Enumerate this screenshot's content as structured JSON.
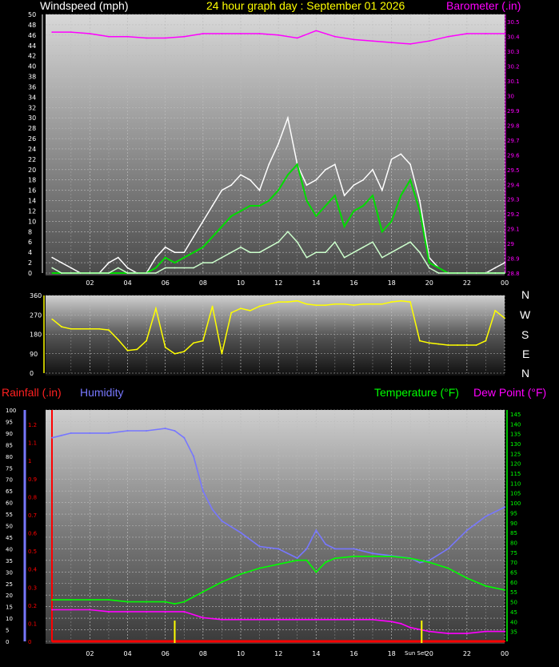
{
  "colors": {
    "wind": "#ffffff",
    "wind_avg": "#00dd00",
    "wind_min": "#ccffcc",
    "barometer": "#ff00ff",
    "direction": "#ffff00",
    "humidity": "#7777ff",
    "temperature": "#00ff00",
    "dewpoint": "#ff00ff",
    "rainfall": "#ff0000",
    "grid": "#bbbbbb"
  },
  "header": {
    "left_label": "Windspeed (mph)",
    "title": "24 hour graph day : September 01 2026",
    "right_label": "Barometer (.in)"
  },
  "lower_header": {
    "rainfall": "Rainfall (.in)",
    "humidity": "Humidity",
    "temperature": "Temperature (°F)",
    "dewpoint": "Dew Point (°F)"
  },
  "compass": [
    "N",
    "W",
    "S",
    "E",
    "N"
  ],
  "x_labels": [
    "02",
    "04",
    "06",
    "08",
    "10",
    "12",
    "14",
    "16",
    "18",
    "20",
    "22",
    "00"
  ],
  "sunset_label": "Sun Set",
  "chart_data": [
    {
      "type": "line",
      "title": "24 hour graph day : September 01 2026",
      "x_hours_ticks": [
        "02",
        "04",
        "06",
        "08",
        "10",
        "12",
        "14",
        "16",
        "18",
        "20",
        "22",
        "00"
      ],
      "y_left_label": "Windspeed (mph)",
      "y_left_ticks": [
        "0",
        "2",
        "4",
        "6",
        "8",
        "10",
        "12",
        "14",
        "16",
        "18",
        "20",
        "22",
        "24",
        "26",
        "28",
        "30",
        "32",
        "34",
        "36",
        "38",
        "40",
        "42",
        "44",
        "46",
        "48",
        "50"
      ],
      "y_right_label": "Barometer (.in)",
      "y_right_ticks": [
        "28.8",
        "28.9",
        "29",
        "29.1",
        "29.2",
        "29.3",
        "29.4",
        "29.5",
        "29.6",
        "29.7",
        "29.8",
        "29.9",
        "30",
        "30.1",
        "30.2",
        "30.3",
        "30.4",
        "30.5"
      ],
      "ylim_left": [
        0,
        50
      ],
      "ylim_right": [
        28.8,
        30.55
      ],
      "series": [
        {
          "color_key": "wind",
          "axis": "left",
          "x": [
            0,
            0.5,
            1,
            1.5,
            2,
            2.5,
            3,
            3.5,
            4,
            4.5,
            5,
            5.5,
            6,
            6.5,
            7,
            7.5,
            8,
            8.5,
            9,
            9.5,
            10,
            10.5,
            11,
            11.5,
            12,
            12.5,
            13,
            13.5,
            14,
            14.5,
            15,
            15.5,
            16,
            16.5,
            17,
            17.5,
            18,
            18.5,
            19,
            19.5,
            20,
            20.5,
            21,
            21.5,
            22,
            22.5,
            23,
            23.5,
            24
          ],
          "values": [
            3,
            2,
            1,
            0,
            0,
            0,
            2,
            3,
            1,
            0,
            0,
            3,
            5,
            4,
            4,
            7,
            10,
            13,
            16,
            17,
            19,
            18,
            16,
            21,
            25,
            30,
            21,
            17,
            18,
            20,
            21,
            15,
            17,
            18,
            20,
            16,
            22,
            23,
            21,
            14,
            3,
            1,
            0,
            0,
            0,
            0,
            0,
            1,
            2
          ]
        },
        {
          "color_key": "wind_avg",
          "axis": "left",
          "x": [
            0,
            0.5,
            1,
            1.5,
            2,
            2.5,
            3,
            3.5,
            4,
            4.5,
            5,
            5.5,
            6,
            6.5,
            7,
            7.5,
            8,
            8.5,
            9,
            9.5,
            10,
            10.5,
            11,
            11.5,
            12,
            12.5,
            13,
            13.5,
            14,
            14.5,
            15,
            15.5,
            16,
            16.5,
            17,
            17.5,
            18,
            18.5,
            19,
            19.5,
            20,
            20.5,
            21,
            21.5,
            22,
            22.5,
            23,
            23.5,
            24
          ],
          "values": [
            0,
            0,
            0,
            0,
            0,
            0,
            0,
            0,
            0,
            0,
            0,
            1,
            3,
            2,
            3,
            4,
            5,
            7,
            9,
            11,
            12,
            13,
            13,
            14,
            16,
            19,
            21,
            14,
            11,
            13,
            15,
            9,
            12,
            13,
            15,
            8,
            10,
            15,
            18,
            12,
            2,
            1,
            0,
            0,
            0,
            0,
            0,
            0,
            0
          ]
        },
        {
          "color_key": "wind_min",
          "axis": "left",
          "x": [
            0,
            0.5,
            1,
            1.5,
            2,
            2.5,
            3,
            3.5,
            4,
            4.5,
            5,
            5.5,
            6,
            6.5,
            7,
            7.5,
            8,
            8.5,
            9,
            9.5,
            10,
            10.5,
            11,
            11.5,
            12,
            12.5,
            13,
            13.5,
            14,
            14.5,
            15,
            15.5,
            16,
            16.5,
            17,
            17.5,
            18,
            18.5,
            19,
            19.5,
            20,
            20.5,
            21,
            21.5,
            22,
            22.5,
            23,
            23.5,
            24
          ],
          "values": [
            1,
            0,
            0,
            0,
            0,
            0,
            0,
            1,
            0,
            0,
            0,
            0,
            1,
            1,
            1,
            1,
            2,
            2,
            3,
            4,
            5,
            4,
            4,
            5,
            6,
            8,
            6,
            3,
            4,
            4,
            6,
            3,
            4,
            5,
            6,
            3,
            4,
            5,
            6,
            4,
            1,
            0,
            0,
            0,
            0,
            0,
            0,
            0,
            0
          ]
        },
        {
          "color_key": "barometer",
          "axis": "right",
          "x": [
            0,
            1,
            2,
            3,
            4,
            5,
            6,
            7,
            8,
            9,
            10,
            11,
            12,
            13,
            14,
            15,
            16,
            17,
            18,
            19,
            20,
            21,
            22,
            23,
            24
          ],
          "values": [
            30.43,
            30.43,
            30.42,
            30.4,
            30.4,
            30.39,
            30.39,
            30.4,
            30.42,
            30.42,
            30.42,
            30.42,
            30.41,
            30.39,
            30.44,
            30.4,
            30.38,
            30.37,
            30.36,
            30.35,
            30.37,
            30.4,
            30.42,
            30.42,
            30.42
          ]
        }
      ]
    },
    {
      "type": "line",
      "title": "",
      "y_ticks": [
        "0",
        "90",
        "180",
        "270",
        "360"
      ],
      "ylim": [
        0,
        360
      ],
      "series": [
        {
          "color_key": "direction",
          "x": [
            0,
            0.5,
            1,
            1.5,
            2,
            2.5,
            3,
            3.5,
            4,
            4.5,
            5,
            5.5,
            6,
            6.5,
            7,
            7.5,
            8,
            8.5,
            9,
            9.5,
            10,
            10.5,
            11,
            11.5,
            12,
            12.5,
            13,
            13.5,
            14,
            14.5,
            15,
            15.5,
            16,
            16.5,
            17,
            17.5,
            18,
            18.5,
            19,
            19.5,
            20,
            20.5,
            21,
            21.5,
            22,
            22.5,
            23,
            23.5,
            24
          ],
          "values": [
            250,
            215,
            205,
            205,
            205,
            205,
            200,
            155,
            105,
            110,
            150,
            300,
            120,
            90,
            100,
            140,
            150,
            310,
            90,
            280,
            300,
            290,
            310,
            320,
            330,
            330,
            335,
            320,
            315,
            315,
            320,
            320,
            315,
            320,
            320,
            320,
            330,
            335,
            330,
            150,
            140,
            135,
            130,
            130,
            130,
            130,
            150,
            290,
            255
          ]
        }
      ]
    },
    {
      "type": "line",
      "title": "",
      "y_left_label": "Humidity",
      "y_left_ticks": [
        "0",
        "5",
        "10",
        "15",
        "20",
        "25",
        "30",
        "35",
        "40",
        "45",
        "50",
        "55",
        "60",
        "65",
        "70",
        "75",
        "80",
        "85",
        "90",
        "95",
        "100"
      ],
      "y_rain_label": "Rainfall (.in)",
      "y_rain_ticks": [
        "0",
        "0.1",
        "0.2",
        "0.3",
        "0.4",
        "0.5",
        "0.6",
        "0.7",
        "0.8",
        "0.9",
        "1",
        "1.1",
        "1.2"
      ],
      "y_right_label": "Temperature (°F)  Dew Point (°F)",
      "y_right_ticks": [
        "35",
        "40",
        "45",
        "50",
        "55",
        "60",
        "65",
        "70",
        "75",
        "80",
        "85",
        "90",
        "95",
        "100",
        "105",
        "110",
        "115",
        "120",
        "125",
        "130",
        "135",
        "140",
        "145"
      ],
      "ylim_left": [
        0,
        100
      ],
      "ylim_right": [
        30,
        147
      ],
      "series": [
        {
          "color_key": "humidity",
          "axis": "left",
          "x": [
            0,
            0.5,
            1,
            2,
            3,
            4,
            5,
            6,
            6.5,
            7,
            7.5,
            8,
            8.5,
            9,
            10,
            11,
            12,
            13,
            13.5,
            14,
            14.5,
            15,
            16,
            17,
            18,
            19,
            19.5,
            20,
            21,
            22,
            23,
            24
          ],
          "values": [
            88,
            89,
            90,
            90,
            90,
            91,
            91,
            92,
            91,
            88,
            80,
            65,
            57,
            52,
            47,
            41,
            40,
            36,
            40,
            48,
            42,
            40,
            40,
            38,
            37,
            36,
            34,
            35,
            40,
            48,
            54,
            58
          ]
        },
        {
          "color_key": "temperature",
          "axis": "right",
          "x": [
            0,
            1,
            2,
            3,
            4,
            5,
            6,
            6.5,
            7,
            8,
            9,
            10,
            11,
            12,
            13,
            13.5,
            14,
            14.5,
            15,
            16,
            17,
            18,
            19,
            20,
            21,
            22,
            23,
            24
          ],
          "values": [
            51,
            51,
            51,
            51,
            50,
            50,
            50,
            49,
            50,
            55,
            60,
            64,
            67,
            69,
            71,
            71,
            65,
            70,
            72,
            73,
            73,
            73,
            72,
            70,
            67,
            62,
            58,
            56
          ]
        },
        {
          "color_key": "dewpoint",
          "axis": "right",
          "x": [
            0,
            1,
            2,
            3,
            4,
            5,
            6,
            7,
            8,
            9,
            10,
            11,
            12,
            13,
            14,
            15,
            16,
            17,
            18,
            18.5,
            19,
            20,
            21,
            22,
            23,
            24
          ],
          "values": [
            46,
            46,
            46,
            45,
            45,
            45,
            45,
            45,
            42,
            41,
            41,
            41,
            41,
            41,
            41,
            41,
            41,
            41,
            40,
            39,
            37,
            35,
            34,
            34,
            35,
            35
          ]
        },
        {
          "color_key": "rainfall",
          "axis": "rain",
          "x": [
            0,
            24
          ],
          "values": [
            0,
            0
          ]
        }
      ]
    }
  ]
}
